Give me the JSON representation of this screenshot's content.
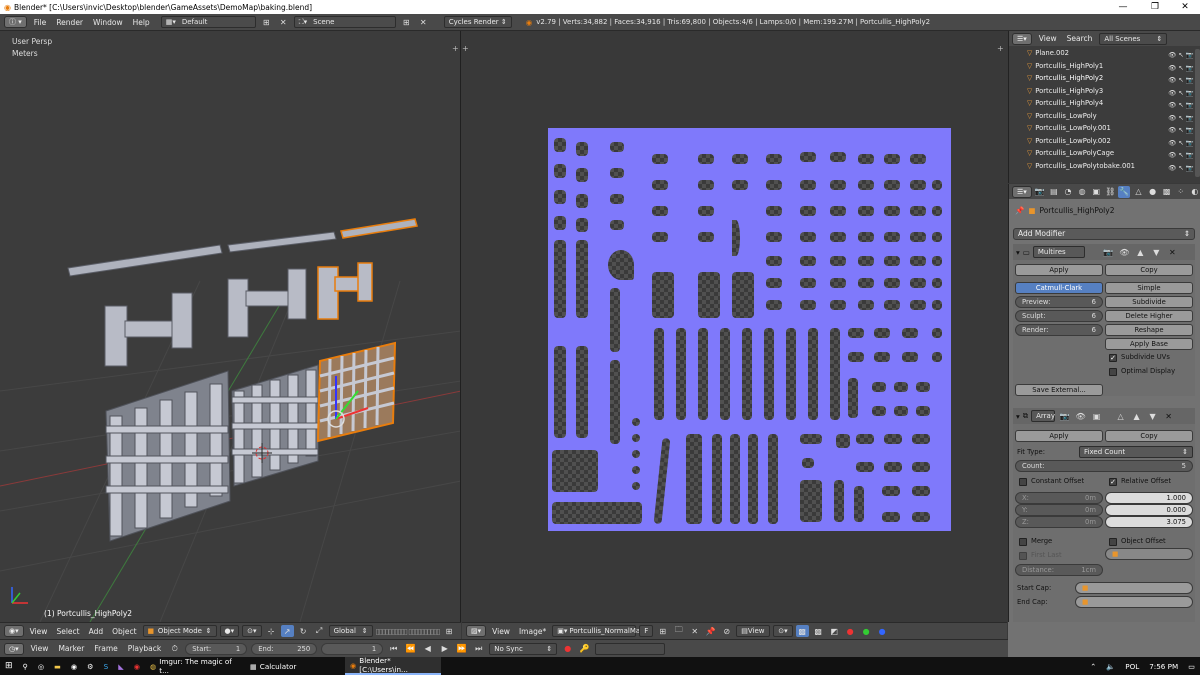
{
  "window": {
    "title": "Blender* [C:\\Users\\invic\\Desktop\\blender\\GameAssets\\DemoMap\\baking.blend]",
    "min": "—",
    "max": "❐",
    "close": "✕"
  },
  "topbar": {
    "menus": [
      "File",
      "Render",
      "Window",
      "Help"
    ],
    "layout": "Default",
    "scene": "Scene",
    "engine": "Cycles Render",
    "stats": "v2.79 | Verts:34,882 | Faces:34,916 | Tris:69,800 | Objects:4/6 | Lamps:0/0 | Mem:199.27M | Portcullis_HighPoly2"
  },
  "viewport3d": {
    "view_name": "User Persp",
    "units": "Meters",
    "object_label": "(1) Portcullis_HighPoly2"
  },
  "outliner": {
    "header": {
      "view": "View",
      "search": "Search",
      "scene_filter": "All Scenes"
    },
    "items": [
      "Plane.002",
      "Portcullis_HighPoly1",
      "Portcullis_HighPoly2",
      "Portcullis_HighPoly3",
      "Portcullis_HighPoly4",
      "Portcullis_LowPoly",
      "Portcullis_LowPoly.001",
      "Portcullis_LowPoly.002",
      "Portcullis_LowPolyCage",
      "Portcullis_LowPolytobake.001"
    ]
  },
  "properties": {
    "breadcrumb": "Portcullis_HighPoly2",
    "add_modifier": "Add Modifier",
    "multires": {
      "name": "Multires",
      "apply": "Apply",
      "copy": "Copy",
      "catmull": "Catmull-Clark",
      "simple": "Simple",
      "preview_label": "Preview:",
      "preview": "6",
      "sculpt_label": "Sculpt:",
      "sculpt": "6",
      "render_label": "Render:",
      "render": "6",
      "subdivide": "Subdivide",
      "delete_higher": "Delete Higher",
      "reshape": "Reshape",
      "apply_base": "Apply Base",
      "subdivide_uvs": "Subdivide UVs",
      "optimal_display": "Optimal Display",
      "save_external": "Save External..."
    },
    "array": {
      "name": "Array",
      "apply": "Apply",
      "copy": "Copy",
      "fit_type_label": "Fit Type:",
      "fit_type": "Fixed Count",
      "count_label": "Count:",
      "count": "5",
      "constant_offset": "Constant Offset",
      "relative_offset": "Relative Offset",
      "cx_label": "X:",
      "cx": "0m",
      "cy_label": "Y:",
      "cy": "0m",
      "cz_label": "Z:",
      "cz": "0m",
      "rx": "1.000",
      "ry": "0.000",
      "rz": "3.075",
      "merge": "Merge",
      "object_offset": "Object Offset",
      "first_last": "First Last",
      "distance_label": "Distance:",
      "distance": "1cm",
      "start_cap": "Start Cap:",
      "end_cap": "End Cap:"
    }
  },
  "header3d": {
    "menus": [
      "View",
      "Select",
      "Add",
      "Object"
    ],
    "mode": "Object Mode",
    "orientation": "Global"
  },
  "headerimg": {
    "menus": [
      "View",
      "Image*"
    ],
    "image_name": "Portcullis_NormalMap",
    "f": "F",
    "view": "View"
  },
  "timeline": {
    "menus": [
      "View",
      "Marker",
      "Frame",
      "Playback"
    ],
    "start_label": "Start:",
    "start": "1",
    "end_label": "End:",
    "end": "250",
    "current": "1",
    "sync": "No Sync"
  },
  "taskbar": {
    "items": [
      "Imgur: The magic of t...",
      "Calculator",
      "Blender* [C:\\Users\\in..."
    ],
    "lang": "POL",
    "time": "7:56 PM"
  }
}
